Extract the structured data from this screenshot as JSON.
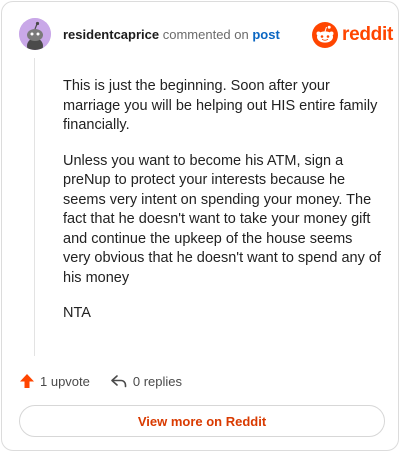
{
  "comment": {
    "username": "residentcaprice",
    "commented_text": "commented on",
    "post_link": "post",
    "paragraphs": [
      "This is just the beginning. Soon after your marriage you will be helping out HIS entire family financially.",
      "Unless you want to become his ATM, sign a preNup to protect your interests because he seems very intent on spending your money. The fact that he doesn't want to take your money gift and continue the upkeep of the house seems very obvious that he doesn't want to spend any of his money",
      "NTA"
    ]
  },
  "brand": {
    "wordmark": "reddit",
    "icon": "reddit-logo-icon",
    "color": "#ff4500"
  },
  "actions": {
    "upvotes": "1 upvote",
    "upvote_icon": "upvote-arrow-icon",
    "upvote_color": "#ff4500",
    "replies": "0 replies",
    "reply_icon": "reply-arrow-icon"
  },
  "footer": {
    "view_more": "View more on Reddit",
    "link_color": "#d93a00"
  }
}
